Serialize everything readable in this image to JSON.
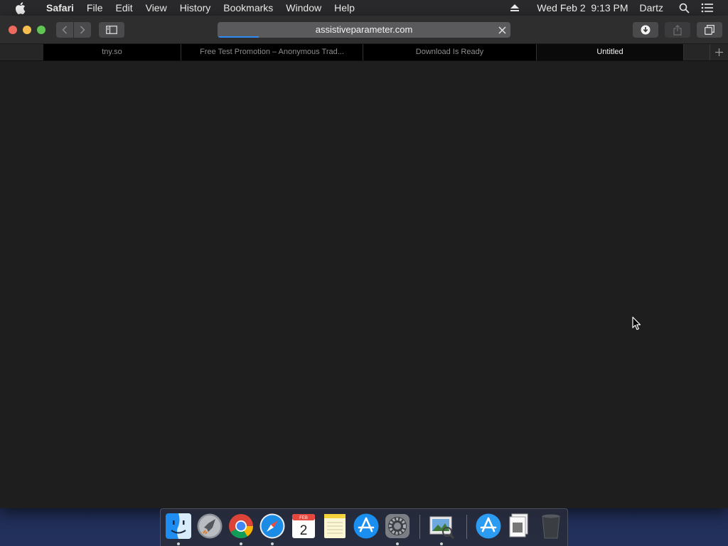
{
  "menubar": {
    "app_name": "Safari",
    "items": [
      "File",
      "Edit",
      "View",
      "History",
      "Bookmarks",
      "Window",
      "Help"
    ],
    "clock": "Wed Feb 2  9:13 PM",
    "user": "Dartz",
    "icons": [
      "apple-icon",
      "eject-icon",
      "spotlight-icon",
      "notification-center-icon"
    ]
  },
  "toolbar": {
    "url": "assistiveparameter.com",
    "load_progress": 0.14,
    "buttons": [
      "back",
      "forward",
      "sidebar",
      "downloads",
      "share",
      "tab-overview"
    ]
  },
  "tabs": [
    {
      "title": "tny.so",
      "active": false
    },
    {
      "title": "Free Test Promotion – Anonymous Trad...",
      "active": false
    },
    {
      "title": "Download Is Ready",
      "active": false
    },
    {
      "title": "Untitled",
      "active": true
    }
  ],
  "dock": {
    "apps": [
      "Finder",
      "Launchpad",
      "Google Chrome",
      "Safari",
      "Calendar",
      "Notes",
      "App Store",
      "System Preferences",
      "Preview",
      "Applications",
      "Documents",
      "Trash"
    ],
    "calendar": {
      "month": "FEB",
      "day": "2"
    },
    "running": [
      "Finder",
      "Google Chrome",
      "Safari",
      "System Preferences",
      "Preview"
    ]
  },
  "colors": {
    "menubar_bg": "#2a2a2c",
    "toolbar_bg": "#2e2e2f",
    "content_bg": "#1e1e1e",
    "progress": "#2f8cf5"
  }
}
